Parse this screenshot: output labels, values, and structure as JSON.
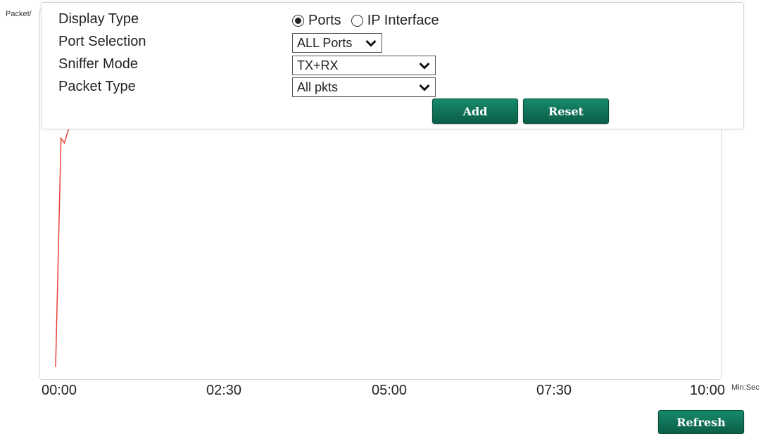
{
  "form": {
    "display_type_label": "Display Type",
    "display_type_options": [
      {
        "label": "Ports",
        "selected": true
      },
      {
        "label": "IP Interface",
        "selected": false
      }
    ],
    "port_selection_label": "Port Selection",
    "port_selection_value": "ALL Ports",
    "sniffer_mode_label": "Sniffer Mode",
    "sniffer_mode_value": "TX+RX",
    "packet_type_label": "Packet Type",
    "packet_type_value": "All pkts",
    "add_label": "Add",
    "reset_label": "Reset"
  },
  "refresh_label": "Refresh",
  "icons": {
    "select_arrow": "chevron-down-icon",
    "radio": "radio-icon"
  },
  "colors": {
    "button": "#0f6e55",
    "series": "#e8413c"
  },
  "chart_data": {
    "type": "line",
    "ylabel": "Packet/",
    "xunit": "Min:Sec",
    "x_ticks": [
      "00:00",
      "02:30",
      "05:00",
      "07:30",
      "10:00"
    ],
    "xlim": [
      "00:00",
      "10:00"
    ],
    "ylim_visible": [
      0,
      1
    ],
    "grid": false,
    "series": [
      {
        "x": [
          "00:00",
          "00:05",
          "00:08",
          "00:12"
        ],
        "y": [
          0.0,
          0.96,
          0.94,
          1.0
        ]
      }
    ]
  }
}
